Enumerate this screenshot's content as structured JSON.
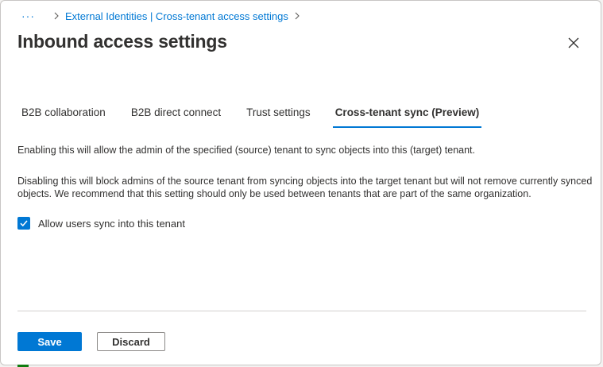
{
  "breadcrumb": {
    "ellipsis": "···",
    "items": [
      {
        "label": "External Identities | Cross-tenant access settings"
      }
    ]
  },
  "header": {
    "title": "Inbound access settings",
    "close_icon": "close-icon"
  },
  "tabs": [
    {
      "label": "B2B collaboration",
      "active": false
    },
    {
      "label": "B2B direct connect",
      "active": false
    },
    {
      "label": "Trust settings",
      "active": false
    },
    {
      "label": "Cross-tenant sync (Preview)",
      "active": true
    }
  ],
  "content": {
    "description_1": "Enabling this will allow the admin of the specified (source) tenant to sync objects into this (target) tenant.",
    "description_2": "Disabling this will block admins of the source tenant from syncing objects into the target tenant but will not remove currently synced objects. We recommend that this setting should only be used between tenants that are part of the same organization.",
    "checkbox": {
      "label": "Allow users sync into this tenant",
      "checked": true
    }
  },
  "footer": {
    "save_label": "Save",
    "discard_label": "Discard"
  },
  "colors": {
    "accent": "#0078d4",
    "text": "#323130",
    "border": "#8a8886"
  }
}
